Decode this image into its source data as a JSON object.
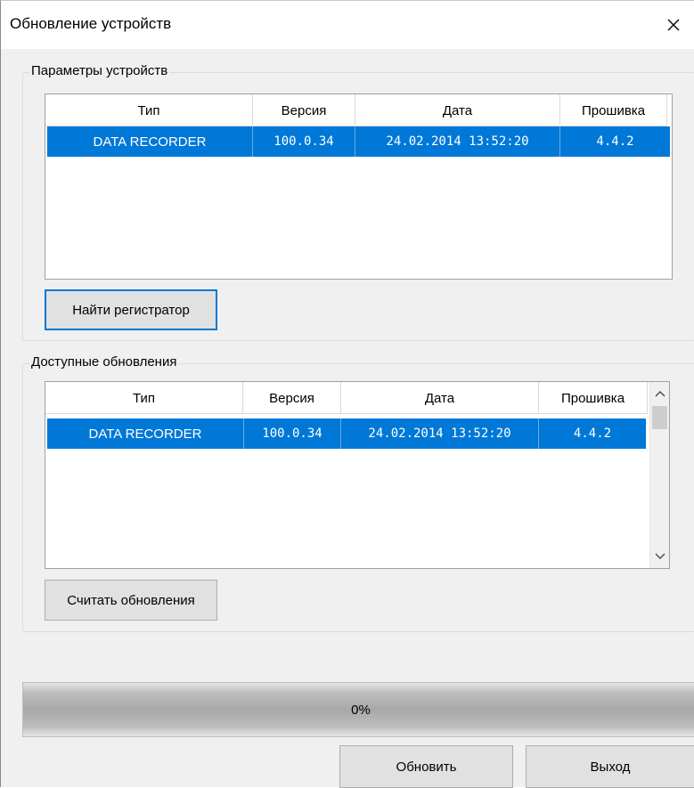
{
  "window": {
    "title": "Обновление устройств"
  },
  "device_params": {
    "label": "Параметры устройств",
    "columns": [
      "Тип",
      "Версия",
      "Дата",
      "Прошивка"
    ],
    "rows": [
      {
        "type": "DATA RECORDER",
        "version": "100.0.34",
        "date": "24.02.2014 13:52:20",
        "firmware": "4.4.2"
      }
    ],
    "find_button": "Найти регистратор"
  },
  "available_updates": {
    "label": "Доступные обновления",
    "columns": [
      "Тип",
      "Версия",
      "Дата",
      "Прошивка"
    ],
    "rows": [
      {
        "type": "DATA RECORDER",
        "version": "100.0.34",
        "date": "24.02.2014 13:52:20",
        "firmware": "4.4.2"
      }
    ],
    "read_button": "Считать обновления"
  },
  "progress": {
    "value": 0,
    "text": "0%"
  },
  "footer": {
    "update_button": "Обновить",
    "exit_button": "Выход"
  },
  "colors": {
    "selection": "#0078d7",
    "progress_fill": "#06b025"
  },
  "icons": {
    "close": "close-icon",
    "scroll_up": "chevron-up-icon",
    "scroll_down": "chevron-down-icon"
  }
}
